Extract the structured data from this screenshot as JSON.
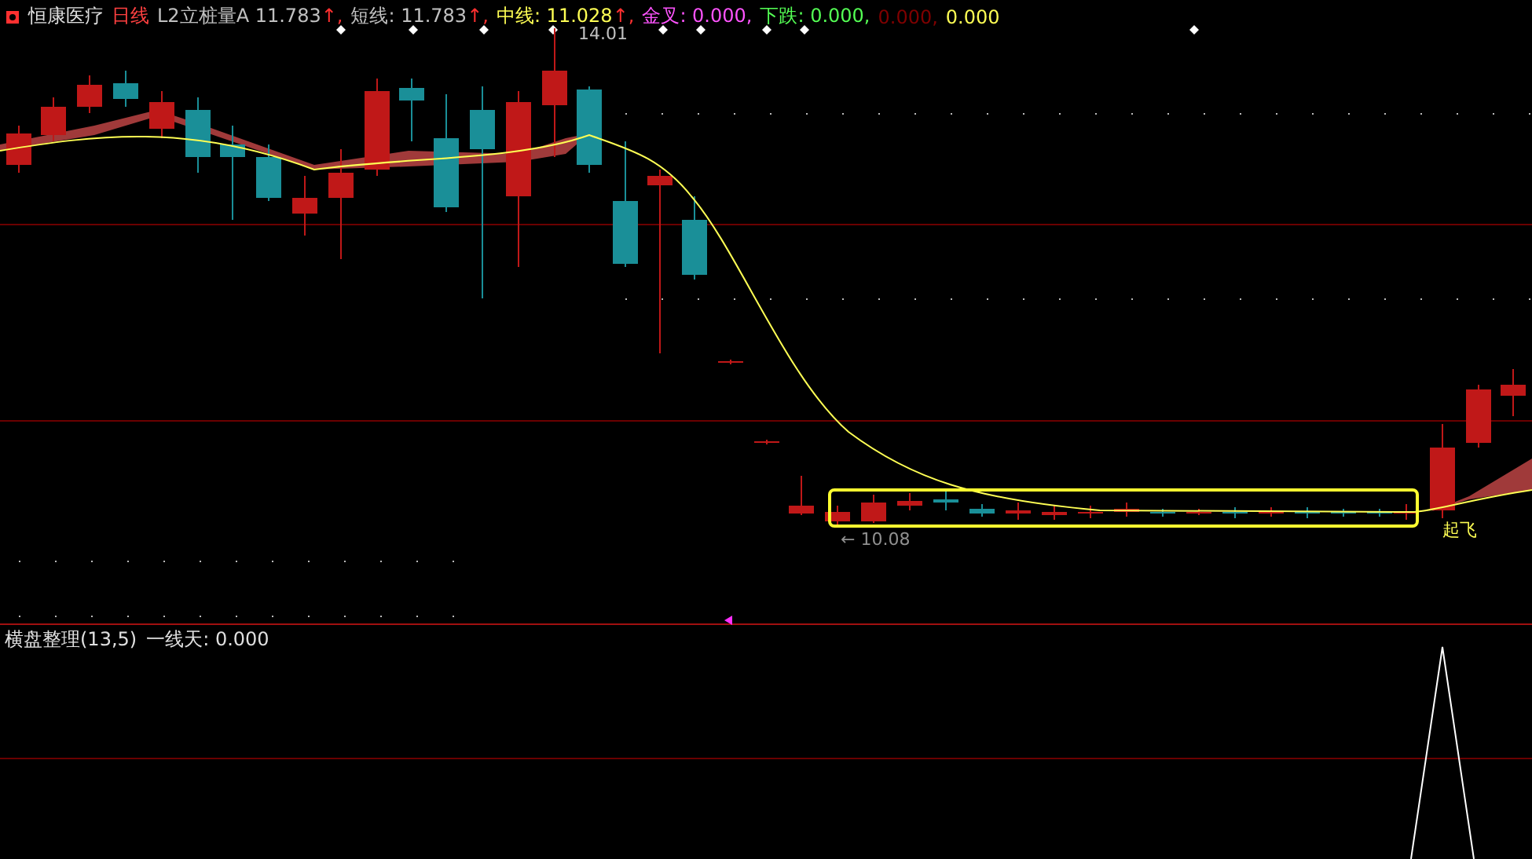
{
  "header": {
    "stock": "恒康医疗",
    "period": "日线",
    "items": [
      {
        "label": "L2立桩量A",
        "value": "11.783",
        "arrow": "↑,",
        "color": "#c0c0c0"
      },
      {
        "label": "短线:",
        "value": "11.783",
        "arrow": "↑,",
        "color": "#c0c0c0"
      },
      {
        "label": "中线:",
        "value": "11.028",
        "arrow": "↑,",
        "color": "#ffff54"
      },
      {
        "label": "金叉:",
        "value": "0.000,",
        "color": "#ff54ff"
      },
      {
        "label": "下跌:",
        "value": "0.000,",
        "color": "#54ff54"
      },
      {
        "value": "0.000,",
        "color": "#800000"
      },
      {
        "value": "0.000",
        "color": "#ffff54"
      }
    ]
  },
  "main_panel": {
    "price_high": "14.01",
    "price_low": "← 10.08",
    "signal": "起飞"
  },
  "lower_panel": {
    "indicator": "横盘整理(13,5)",
    "items": [
      {
        "label": "一线天:",
        "value": "0.000"
      }
    ]
  }
}
